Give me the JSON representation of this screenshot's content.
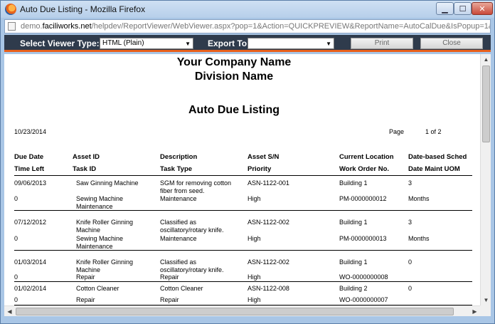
{
  "window": {
    "title": "Auto Due Listing - Mozilla Firefox",
    "url_prefix": "demo.",
    "url_domain": "faciliworks.net",
    "url_rest": "/helpdev/ReportViewer/WebViewer.aspx?pop=1&Action=QUICKPREVIEW&ReportName=AutoCalDue&IsPopup=1&IsPopu"
  },
  "toolbar": {
    "viewer_label": "Select Viewer Type:",
    "viewer_value": "HTML (Plain)",
    "export_label": "Export To:",
    "export_value": "",
    "print_label": "Print",
    "close_label": "Close"
  },
  "report": {
    "company": "Your Company Name",
    "division": "Division Name",
    "title": "Auto Due Listing",
    "run_date": "10/23/2014",
    "page_label": "Page",
    "page_num": "1   of  2"
  },
  "headers": {
    "row1": [
      "Due Date",
      "Asset ID",
      "Description",
      "Asset S/N",
      "Current Location",
      "Date-based Sched"
    ],
    "row2": [
      "Time Left",
      "Task ID",
      "Task Type",
      "Priority",
      "Work Order No.",
      "Date Maint UOM"
    ]
  },
  "records": [
    {
      "due_date": "09/06/2013",
      "asset_id": [
        "Saw Ginning Machine"
      ],
      "description": [
        "SGM for removing cotton",
        "fiber from seed."
      ],
      "asset_sn": "ASN-1122-001",
      "location": "Building 1",
      "sched": "3",
      "time_left": "0",
      "task_id": [
        "Sewing Machine",
        "Maintenance"
      ],
      "task_type": "Maintenance",
      "priority": "High",
      "wo_no": "PM-0000000012",
      "uom": "Months"
    },
    {
      "due_date": "07/12/2012",
      "asset_id": [
        "Knife Roller Ginning",
        "Machine"
      ],
      "description": [
        "Classified as",
        "oscillatory/rotary knife."
      ],
      "asset_sn": "ASN-1122-002",
      "location": "Building 1",
      "sched": "3",
      "time_left": "0",
      "task_id": [
        "Sewing Machine",
        "Maintenance"
      ],
      "task_type": "Maintenance",
      "priority": "High",
      "wo_no": "PM-0000000013",
      "uom": "Months"
    },
    {
      "due_date": "01/03/2014",
      "asset_id": [
        "Knife Roller Ginning",
        "Machine"
      ],
      "description": [
        "Classified as",
        "oscillatory/rotary knife."
      ],
      "asset_sn": "ASN-1122-002",
      "location": "Building 1",
      "sched": "0",
      "time_left": "0",
      "task_id": [
        "Repair"
      ],
      "task_type": "Repair",
      "priority": "High",
      "wo_no": "WO-0000000008",
      "uom": ""
    },
    {
      "due_date": "01/02/2014",
      "asset_id": [
        "Cotton Cleaner"
      ],
      "description": [
        "Cotton Cleaner"
      ],
      "asset_sn": "ASN-1122-008",
      "location": "Building 2",
      "sched": "0",
      "time_left": "0",
      "task_id": [
        "Repair"
      ],
      "task_type": "Repair",
      "priority": "High",
      "wo_no": "WO-0000000007",
      "uom": ""
    }
  ]
}
